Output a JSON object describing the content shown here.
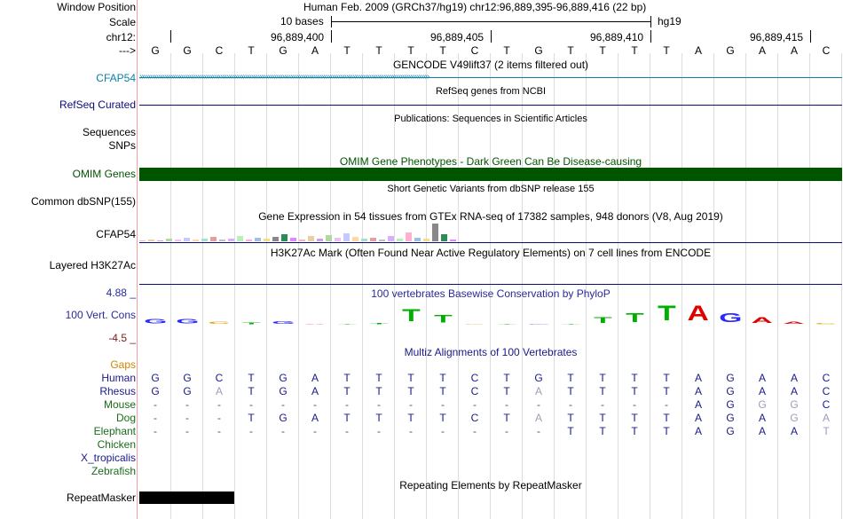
{
  "position": {
    "window_label": "Window Position",
    "window_value": "Human Feb. 2009 (GRCh37/hg19)   chr12:96,889,395-96,889,416 (22 bp)",
    "scale_label": "Scale",
    "scale_text": "10 bases",
    "scale_assembly": "hg19",
    "chrom_label": "chr12:",
    "ticks": [
      "96,889,400",
      "96,889,405",
      "96,889,410",
      "96,889,415"
    ],
    "strand_label": "--->",
    "sequence": [
      "G",
      "G",
      "C",
      "T",
      "G",
      "A",
      "T",
      "T",
      "T",
      "T",
      "C",
      "T",
      "G",
      "T",
      "T",
      "T",
      "T",
      "A",
      "G",
      "A",
      "A",
      "C"
    ]
  },
  "tracks": {
    "gencode_title": "GENCODE V49lift37 (2 items filtered out)",
    "cfap54_label": "CFAP54",
    "refseq_title": "RefSeq genes from NCBI",
    "refseq_label": "RefSeq Curated",
    "publications_title": "Publications: Sequences in Scientific Articles",
    "sequences_label": "Sequences",
    "snps_label": "SNPs",
    "omim_title": "OMIM Gene Phenotypes - Dark Green Can Be Disease-causing",
    "omim_label": "OMIM Genes",
    "dbsnp_title": "Short Genetic Variants from dbSNP release 155",
    "dbsnp_label": "Common dbSNP(155)",
    "gtex_title": "Gene Expression in 54 tissues from GTEx RNA-seq of 17382 samples, 948 donors (V8, Aug 2019)",
    "gtex_label": "CFAP54",
    "h3k27ac_title": "H3K27Ac Mark (Often Found Near Active Regulatory Elements) on 7 cell lines from ENCODE",
    "h3k27ac_label": "Layered H3K27Ac",
    "phylop_title": "100 vertebrates Basewise Conservation by PhyloP",
    "phylop_label": "100 Vert. Cons",
    "phylop_max": "4.88 _",
    "phylop_min": "-4.5 _",
    "multiz_title": "Multiz Alignments of 100 Vertebrates",
    "gaps_label": "Gaps",
    "repeat_title": "Repeating Elements by RepeatMasker",
    "repeat_label": "RepeatMasker"
  },
  "alignment": [
    {
      "species": "Human",
      "color": "#1a1a8c",
      "bases": [
        "G",
        "G",
        "C",
        "T",
        "G",
        "A",
        "T",
        "T",
        "T",
        "T",
        "C",
        "T",
        "G",
        "T",
        "T",
        "T",
        "T",
        "A",
        "G",
        "A",
        "A",
        "C"
      ]
    },
    {
      "species": "Rhesus",
      "color": "#1a1a8c",
      "bases": [
        "G",
        "G",
        "A",
        "T",
        "G",
        "A",
        "T",
        "T",
        "T",
        "T",
        "C",
        "T",
        "A",
        "T",
        "T",
        "T",
        "T",
        "A",
        "G",
        "A",
        "A",
        "C"
      ]
    },
    {
      "species": "Mouse",
      "color": "#1a6b1a",
      "bases": [
        "-",
        "-",
        "-",
        "-",
        "-",
        "-",
        "-",
        "-",
        "-",
        "-",
        "-",
        "-",
        "-",
        "-",
        "-",
        "-",
        "-",
        "A",
        "G",
        "G",
        "G",
        "C"
      ]
    },
    {
      "species": "Dog",
      "color": "#1a6b1a",
      "bases": [
        "-",
        "-",
        "-",
        "T",
        "G",
        "A",
        "T",
        "T",
        "T",
        "T",
        "C",
        "T",
        "A",
        "T",
        "T",
        "T",
        "T",
        "A",
        "G",
        "A",
        "G",
        "A"
      ]
    },
    {
      "species": "Elephant",
      "color": "#1a6b1a",
      "bases": [
        "-",
        "-",
        "-",
        "-",
        "-",
        "-",
        "-",
        "-",
        "-",
        "-",
        "-",
        "-",
        "-",
        "T",
        "T",
        "T",
        "T",
        "A",
        "G",
        "A",
        "A",
        "T"
      ]
    },
    {
      "species": "Chicken",
      "color": "#1a6b1a",
      "bases": []
    },
    {
      "species": "X_tropicalis",
      "color": "#1a1a8c",
      "bases": []
    },
    {
      "species": "Zebrafish",
      "color": "#1a6b1a",
      "bases": []
    }
  ],
  "colors": {
    "gencode_blue": "#0c7fa6",
    "refseq_navy": "#0c0c78",
    "omim_green": "#005500",
    "phylop_blue": "#2a2a9a",
    "phylop_red": "#7a1a1a",
    "gaps_orange": "#cc8800"
  }
}
